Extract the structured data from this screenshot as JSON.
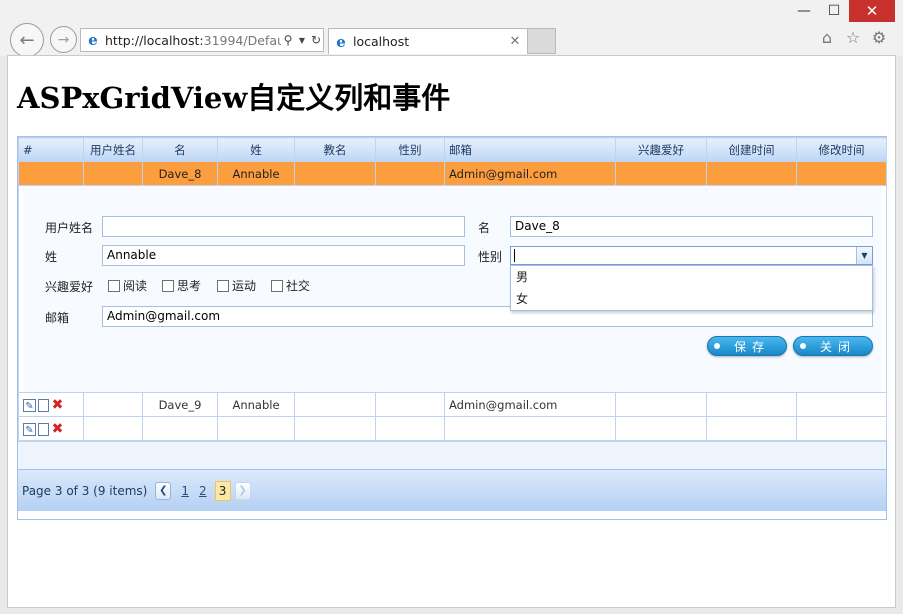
{
  "browser": {
    "url_host": "http://localhost:",
    "url_rest": "31994/Defau",
    "tab_title": "localhost",
    "window_controls": [
      "minimize-icon",
      "maximize-icon",
      "close-icon"
    ],
    "toolbar_icons": [
      "home-icon",
      "star-icon",
      "gear-icon"
    ]
  },
  "page": {
    "title": "ASPxGridView自定义列和事件"
  },
  "grid": {
    "columns": [
      "#",
      "用户姓名",
      "名",
      "姓",
      "教名",
      "性别",
      "邮箱",
      "兴趣爱好",
      "创建时间",
      "修改时间"
    ],
    "selected_row": {
      "cmd": "",
      "user": "",
      "first": "Dave_8",
      "last": "Annable",
      "nick": "",
      "gender": "",
      "email": "Admin@gmail.com",
      "hobby": "",
      "created": "",
      "modified": ""
    },
    "rows": [
      {
        "first": "Dave_9",
        "last": "Annable",
        "nick": "",
        "gender": "",
        "email": "Admin@gmail.com",
        "hobby": "",
        "created": "",
        "modified": ""
      },
      {
        "first": "",
        "last": "",
        "nick": "",
        "gender": "",
        "email": "",
        "hobby": "",
        "created": "",
        "modified": ""
      }
    ]
  },
  "editform": {
    "username_label": "用户姓名",
    "username_value": "",
    "first_label": "名",
    "first_value": "Dave_8",
    "last_label": "姓",
    "last_value": "Annable",
    "gender_label": "性别",
    "gender_value": "",
    "gender_options": [
      "男",
      "女"
    ],
    "hobby_label": "兴趣爱好",
    "hobbies": [
      "阅读",
      "思考",
      "运动",
      "社交"
    ],
    "email_label": "邮箱",
    "email_value": "Admin@gmail.com",
    "save_label": "保存",
    "close_label": "关闭"
  },
  "pager": {
    "summary": "Page 3 of 3 (9 items)",
    "pages": [
      "1",
      "2"
    ],
    "current": "3"
  }
}
